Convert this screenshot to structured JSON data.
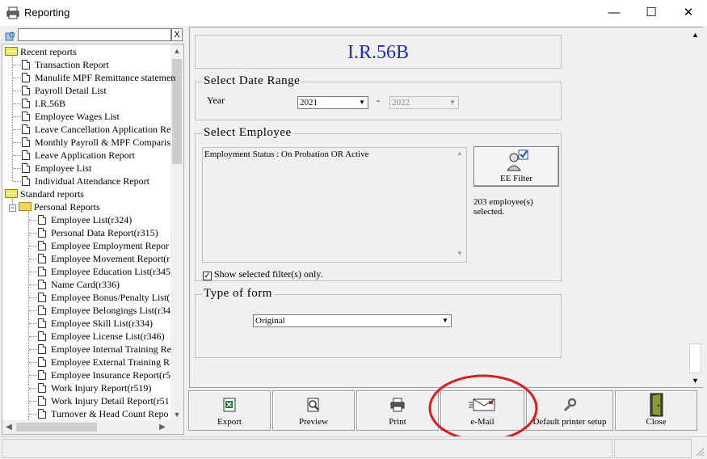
{
  "window": {
    "title": "Reporting",
    "controls": {
      "minimize": "—",
      "maximize": "☐",
      "close": "✕"
    }
  },
  "sidebar": {
    "search": {
      "value": "",
      "clear_label": "X"
    },
    "groups": [
      {
        "label": "Recent reports",
        "items": [
          "Transaction Report",
          "Manulife MPF Remittance statemen",
          "Payroll Detail List",
          "I.R.56B",
          "Employee Wages List",
          "Leave Cancellation Application Re",
          "Monthly Payroll & MPF Comparis",
          "Leave Application Report",
          "Employee List",
          "Individual Attendance Report"
        ]
      },
      {
        "label": "Standard reports",
        "folder": {
          "label": "Personal Reports",
          "expander": "−",
          "items": [
            "Employee List(r324)",
            "Personal Data Report(r315)",
            "Employee Employment Repor",
            "Employee Movement Report(r",
            "Employee Education List(r345",
            "Name Card(r336)",
            "Employee Bonus/Penalty List(",
            "Employee Belongings List(r34",
            "Employee Skill List(r334)",
            "Employee License List(r346)",
            "Employee Internal Training Re",
            "Employee External Training R",
            "Employee Insurance Report(r5",
            "Work Injury Report(r519)",
            "Work Injury Detail Report(r51",
            "Turnover & Head Count Repo"
          ]
        }
      }
    ]
  },
  "form": {
    "title": "I.R.56B",
    "date_range": {
      "legend": "Select Date Range",
      "year_label": "Year",
      "year_from": "2021",
      "separator": "-",
      "year_to": "2022"
    },
    "employee": {
      "legend": "Select Employee",
      "filter_text": "Employment Status : On Probation OR Active",
      "ee_filter_label": "EE Filter",
      "selected_count_text": "203 employee(s) selected.",
      "show_selected_label": "Show selected filter(s) only.",
      "show_selected_checked": true
    },
    "form_type": {
      "legend": "Type of form",
      "value": "Original"
    }
  },
  "toolbar": {
    "buttons": [
      {
        "label": "Export",
        "icon": "excel-icon"
      },
      {
        "label": "Preview",
        "icon": "preview-icon"
      },
      {
        "label": "Print",
        "icon": "printer-icon"
      },
      {
        "label": "e-Mail",
        "icon": "email-icon"
      },
      {
        "label": "Default printer setup",
        "icon": "wrench-icon"
      },
      {
        "label": "Close",
        "icon": "door-icon"
      }
    ]
  },
  "colors": {
    "title_blue": "#1f2fb5",
    "highlight_red": "#d81e1e"
  }
}
